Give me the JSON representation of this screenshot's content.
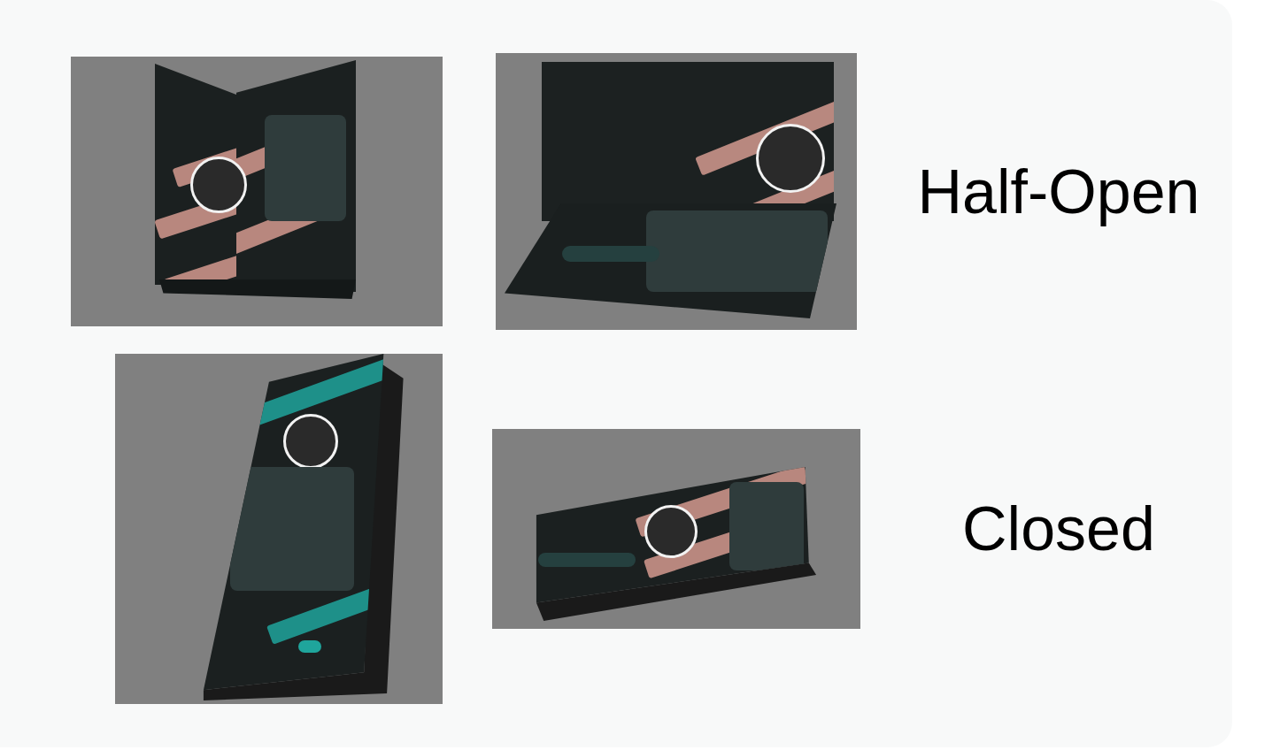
{
  "rows": [
    {
      "label": "Half-Open",
      "renders": [
        {
          "kind": "book",
          "color": "#d49a8f"
        },
        {
          "kind": "laptop",
          "color": "#d49a8f"
        }
      ]
    },
    {
      "label": "Closed",
      "renders": [
        {
          "kind": "portrait",
          "color": "#1fa59c"
        },
        {
          "kind": "landscape",
          "color": "#d49a8f"
        }
      ]
    }
  ]
}
